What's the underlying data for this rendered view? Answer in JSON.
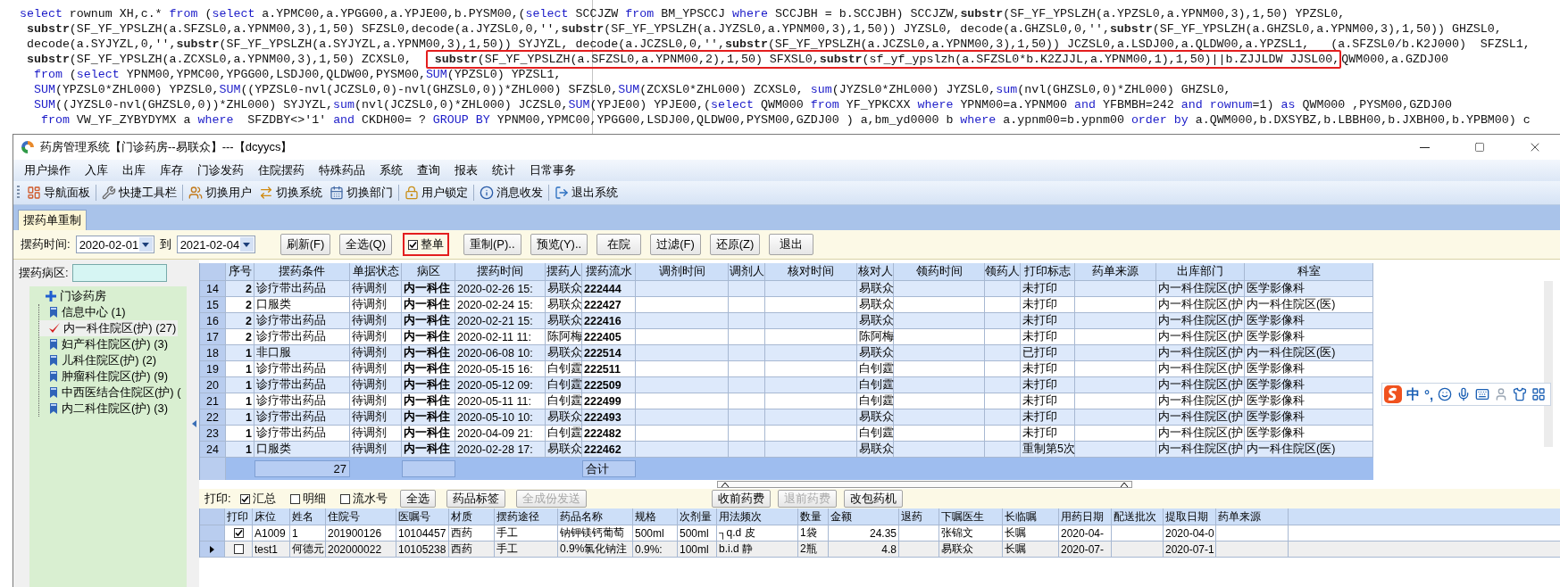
{
  "sql_editor": {
    "lines": [
      {
        "segments": [
          {
            "text": "select",
            "kind": "keyword"
          },
          {
            "text": " rownum XH,c.* ",
            "kind": "plain"
          },
          {
            "text": "from",
            "kind": "keyword"
          },
          {
            "text": " (",
            "kind": "plain"
          },
          {
            "text": "select",
            "kind": "keyword"
          },
          {
            "text": " a.YPMC00,a.YPGG00,a.YPJE00,b.PYSM00,(",
            "kind": "plain"
          },
          {
            "text": "select",
            "kind": "keyword"
          },
          {
            "text": " SCCJZW ",
            "kind": "plain"
          },
          {
            "text": "from",
            "kind": "keyword"
          },
          {
            "text": " BM_YPSCCJ ",
            "kind": "plain"
          },
          {
            "text": "where",
            "kind": "keyword"
          },
          {
            "text": " SCCJBH = b.SCCJBH) SCCJZW,",
            "kind": "plain"
          },
          {
            "text": "substr",
            "kind": "function"
          },
          {
            "text": "(SF_YF_YPSLZH(a.YPZSL0,a.YPNM00,3),1,50) YPZSL0,",
            "kind": "plain"
          }
        ]
      },
      {
        "segments": [
          {
            "text": " substr",
            "kind": "function"
          },
          {
            "text": "(SF_YF_YPSLZH(a.SFZSL0,a.YPNM00,3),1,50) SFZSL0,decode(a.JYZSL0,0,'',",
            "kind": "plain"
          },
          {
            "text": "substr",
            "kind": "function"
          },
          {
            "text": "(SF_YF_YPSLZH(a.JYZSL0,a.YPNM00,3),1,50)) JYZSL0, decode(a.GHZSL0,0,'',",
            "kind": "plain"
          },
          {
            "text": "substr",
            "kind": "function"
          },
          {
            "text": "(SF_YF_YPSLZH(a.GHZSL0,a.YPNM00,3),1,50)) GHZSL0,",
            "kind": "plain"
          }
        ]
      },
      {
        "segments": [
          {
            "text": " decode(a.SYJYZL,0,'',",
            "kind": "plain"
          },
          {
            "text": "substr",
            "kind": "function"
          },
          {
            "text": "(SF_YF_YPSLZH(a.SYJYZL,a.YPNM00,3),1,50)) SYJYZL, decode(a.JCZSL0,0,'',",
            "kind": "plain"
          },
          {
            "text": "substr",
            "kind": "function"
          },
          {
            "text": "(SF_YF_YPSLZH(a.JCZSL0,a.YPNM00,3),1,50)) JCZSL0,a.LSDJ00,a.QLDW00,a.YPZSL1,   (a.SFZSL0/b.K2J000)  SFZSL1,",
            "kind": "plain"
          }
        ]
      },
      {
        "segments": [
          {
            "text": " substr",
            "kind": "function"
          },
          {
            "text": "(SF_YF_YPSLZH(a.ZCXSL0,a.YPNM00,3),1,50) ZCXSL0,  ",
            "kind": "plain"
          },
          {
            "kind": "highlight",
            "segments": [
              {
                "text": " substr",
                "kind": "function"
              },
              {
                "text": "(SF_YF_YPSLZH(a.SFZSL0,a.YPNM00,2),1,50) SFXSL0,",
                "kind": "plain"
              },
              {
                "text": "substr",
                "kind": "function"
              },
              {
                "text": "(sf_yf_ypslzh(a.SFZSL0*b.K2ZJJL,a.YPNM00,1),1,50)||b.ZJJLDW JJSL00,",
                "kind": "plain"
              }
            ]
          },
          {
            "text": "QWM000,a.GZDJ00",
            "kind": "plain"
          }
        ]
      },
      {
        "segments": [
          {
            "text": "  from",
            "kind": "keyword"
          },
          {
            "text": " (",
            "kind": "plain"
          },
          {
            "text": "select",
            "kind": "keyword"
          },
          {
            "text": " YPNM00,YPMC00,YPGG00,LSDJ00,QLDW00,PYSM00,",
            "kind": "plain"
          },
          {
            "text": "SUM",
            "kind": "keyword"
          },
          {
            "text": "(YPZSL0) YPZSL1,",
            "kind": "plain"
          }
        ]
      },
      {
        "segments": [
          {
            "text": "  SUM",
            "kind": "keyword"
          },
          {
            "text": "(YPZSL0*ZHL000) YPZSL0,",
            "kind": "plain"
          },
          {
            "text": "SUM",
            "kind": "keyword"
          },
          {
            "text": "((YPZSL0-nvl(JCZSL0,0)-nvl(GHZSL0,0))*ZHL000) SFZSL0,",
            "kind": "plain"
          },
          {
            "text": "SUM",
            "kind": "keyword"
          },
          {
            "text": "(ZCXSL0*ZHL000) ZCXSL0, ",
            "kind": "plain"
          },
          {
            "text": "sum",
            "kind": "keyword"
          },
          {
            "text": "(JYZSL0*ZHL000) JYZSL0,",
            "kind": "plain"
          },
          {
            "text": "sum",
            "kind": "keyword"
          },
          {
            "text": "(nvl(GHZSL0,0)*ZHL000) GHZSL0,",
            "kind": "plain"
          }
        ]
      },
      {
        "segments": [
          {
            "text": "  SUM",
            "kind": "keyword"
          },
          {
            "text": "((JYZSL0-nvl(GHZSL0,0))*ZHL000) SYJYZL,",
            "kind": "plain"
          },
          {
            "text": "sum",
            "kind": "keyword"
          },
          {
            "text": "(nvl(JCZSL0,0)*ZHL000) JCZSL0,",
            "kind": "plain"
          },
          {
            "text": "SUM",
            "kind": "keyword"
          },
          {
            "text": "(YPJE00) YPJE00,(",
            "kind": "plain"
          },
          {
            "text": "select",
            "kind": "keyword"
          },
          {
            "text": " QWM000 ",
            "kind": "plain"
          },
          {
            "text": "from",
            "kind": "keyword"
          },
          {
            "text": " YF_YPKCXX ",
            "kind": "plain"
          },
          {
            "text": "where",
            "kind": "keyword"
          },
          {
            "text": " YPNM00=a.YPNM00 ",
            "kind": "plain"
          },
          {
            "text": "and",
            "kind": "keyword"
          },
          {
            "text": " YFBMBH=242 ",
            "kind": "plain"
          },
          {
            "text": "and rownum",
            "kind": "keyword"
          },
          {
            "text": "=1) ",
            "kind": "plain"
          },
          {
            "text": "as",
            "kind": "keyword"
          },
          {
            "text": " QWM000 ,PYSM00,GZDJ00",
            "kind": "plain"
          }
        ]
      },
      {
        "segments": [
          {
            "text": "   from",
            "kind": "keyword"
          },
          {
            "text": " VW_YF_ZYBYDYMX a ",
            "kind": "plain"
          },
          {
            "text": "where",
            "kind": "keyword"
          },
          {
            "text": "  SFZDBY<>'1' ",
            "kind": "plain"
          },
          {
            "text": "and",
            "kind": "keyword"
          },
          {
            "text": " CKDH00= ? ",
            "kind": "plain"
          },
          {
            "text": "GROUP BY",
            "kind": "keyword"
          },
          {
            "text": " YPNM00,YPMC00,YPGG00,LSDJ00,QLDW00,PYSM00,GZDJ00 ) a,bm_yd0000 b ",
            "kind": "plain"
          },
          {
            "text": "where",
            "kind": "keyword"
          },
          {
            "text": " a.ypnm00=b.ypnm00 ",
            "kind": "plain"
          },
          {
            "text": "order by",
            "kind": "keyword"
          },
          {
            "text": " a.QWM000,b.DXSYBZ,b.LBBH00,b.JXBH00,b.YPBM00) c",
            "kind": "plain"
          }
        ]
      }
    ]
  },
  "window": {
    "title": "药房管理系统【门诊药房--易联众】---【dcyycs】"
  },
  "menu": [
    "用户操作",
    "入库",
    "出库",
    "库存",
    "门诊发药",
    "住院摆药",
    "特殊药品",
    "系统",
    "查询",
    "报表",
    "统计",
    "日常事务"
  ],
  "toolbar": [
    [
      "导航面板"
    ],
    [
      "快捷工具栏"
    ],
    [
      "切换用户",
      "切换系统",
      "切换部门"
    ],
    [
      "用户锁定"
    ],
    [
      "消息收发"
    ],
    [
      "退出系统"
    ]
  ],
  "tabs": [
    {
      "label": "摆药单重制",
      "selected": true
    }
  ],
  "filter_bar": {
    "time_label": "摆药时间:",
    "date_from": "2020-02-01",
    "to_label": "到",
    "date_to": "2021-02-04",
    "controls": [
      {
        "kind": "button",
        "label": "刷新(F)"
      },
      {
        "kind": "button",
        "label": "全选(Q)"
      },
      {
        "kind": "checkbox",
        "label": "整单",
        "checked": true,
        "highlighted": true
      },
      {
        "kind": "button",
        "label": "重制(P).."
      },
      {
        "kind": "button",
        "label": "预览(Y).."
      },
      {
        "kind": "button",
        "label": "在院"
      },
      {
        "kind": "button",
        "label": "过滤(F)"
      },
      {
        "kind": "button",
        "label": "还原(Z)"
      },
      {
        "kind": "button",
        "label": "退出"
      }
    ]
  },
  "ward_panel": {
    "label": "摆药病区:",
    "tree": [
      {
        "label": "门诊药房",
        "children": [
          {
            "label": "信息中心 (1)",
            "selected": false
          },
          {
            "label": "内一科住院区(护) (27)",
            "selected": true
          },
          {
            "label": "妇产科住院区(护) (3)",
            "selected": false
          },
          {
            "label": "儿科住院区(护) (2)",
            "selected": false
          },
          {
            "label": "肿瘤科住院区(护) (9)",
            "selected": false
          },
          {
            "label": "中西医结合住院区(护) (",
            "selected": false
          },
          {
            "label": "内二科住院区(护) (3)",
            "selected": false
          }
        ]
      }
    ]
  },
  "order_table": {
    "columns": [
      "序号",
      "摆药条件",
      "单据状态",
      "病区",
      "摆药时间",
      "摆药人",
      "摆药流水",
      "调剂时间",
      "调剂人",
      "核对时间",
      "核对人",
      "领药时间",
      "领药人",
      "打印标志",
      "药单来源",
      "出库部门",
      "科室"
    ],
    "rows": [
      {
        "row": "14",
        "cells": [
          "2",
          "诊疗带出药品",
          "待调剂",
          "内一科住",
          "2020-02-26 15:",
          "易联众",
          "222444",
          null,
          null,
          null,
          "易联众",
          null,
          null,
          "未打印",
          null,
          "内一科住院区(护",
          "医学影像科"
        ]
      },
      {
        "row": "15",
        "cells": [
          "2",
          "口服类",
          "待调剂",
          "内一科住",
          "2020-02-24 15:",
          "易联众",
          "222427",
          null,
          null,
          null,
          "易联众",
          null,
          null,
          "未打印",
          null,
          "内一科住院区(护",
          "内一科住院区(医)"
        ]
      },
      {
        "row": "16",
        "cells": [
          "2",
          "诊疗带出药品",
          "待调剂",
          "内一科住",
          "2020-02-21 15:",
          "易联众",
          "222416",
          null,
          null,
          null,
          "易联众",
          null,
          null,
          "未打印",
          null,
          "内一科住院区(护",
          "医学影像科"
        ]
      },
      {
        "row": "17",
        "cells": [
          "2",
          "诊疗带出药品",
          "待调剂",
          "内一科住",
          "2020-02-11 11:",
          "陈阿梅",
          "222405",
          null,
          null,
          null,
          "陈阿梅",
          null,
          null,
          "未打印",
          null,
          "内一科住院区(护",
          "医学影像科"
        ]
      },
      {
        "row": "18",
        "cells": [
          "1",
          "非口服",
          "待调剂",
          "内一科住",
          "2020-06-08 10:",
          "易联众",
          "222514",
          null,
          null,
          null,
          "易联众",
          null,
          null,
          "已打印",
          null,
          "内一科住院区(护",
          "内一科住院区(医)"
        ]
      },
      {
        "row": "19",
        "cells": [
          "1",
          "诊疗带出药品",
          "待调剂",
          "内一科住",
          "2020-05-15 16:",
          "白钊霆",
          "222511",
          null,
          null,
          null,
          "白钊霆",
          null,
          null,
          "未打印",
          null,
          "内一科住院区(护",
          "医学影像科"
        ]
      },
      {
        "row": "20",
        "cells": [
          "1",
          "诊疗带出药品",
          "待调剂",
          "内一科住",
          "2020-05-12 09:",
          "白钊霆",
          "222509",
          null,
          null,
          null,
          "白钊霆",
          null,
          null,
          "未打印",
          null,
          "内一科住院区(护",
          "医学影像科"
        ]
      },
      {
        "row": "21",
        "cells": [
          "1",
          "诊疗带出药品",
          "待调剂",
          "内一科住",
          "2020-05-11 11:",
          "白钊霆",
          "222499",
          null,
          null,
          null,
          "白钊霆",
          null,
          null,
          "未打印",
          null,
          "内一科住院区(护",
          "医学影像科"
        ]
      },
      {
        "row": "22",
        "cells": [
          "1",
          "诊疗带出药品",
          "待调剂",
          "内一科住",
          "2020-05-10 10:",
          "易联众",
          "222493",
          null,
          null,
          null,
          "易联众",
          null,
          null,
          "未打印",
          null,
          "内一科住院区(护",
          "医学影像科"
        ]
      },
      {
        "row": "23",
        "cells": [
          "1",
          "诊疗带出药品",
          "待调剂",
          "内一科住",
          "2020-04-09 21:",
          "白钊霆",
          "222482",
          null,
          null,
          null,
          "白钊霆",
          null,
          null,
          "未打印",
          null,
          "内一科住院区(护",
          "医学影像科"
        ]
      },
      {
        "row": "24",
        "cells": [
          "1",
          "口服类",
          "待调剂",
          "内一科住",
          "2020-02-28 17:",
          "易联众",
          "222462",
          null,
          null,
          null,
          "易联众",
          null,
          null,
          "重制第5次",
          null,
          "内一科住院区(护",
          "内一科住院区(医)"
        ]
      }
    ],
    "footer": [
      "27",
      "合计"
    ]
  },
  "print_bar": {
    "label": "打印:",
    "options": [
      {
        "label": "汇总",
        "checked": true
      },
      {
        "label": "明细",
        "checked": false
      },
      {
        "label": "流水号",
        "checked": false
      }
    ],
    "buttons": [
      {
        "label": "全选",
        "disabled": false
      },
      {
        "label": "药品标签",
        "disabled": false
      },
      {
        "label": "全成份发送",
        "disabled": true
      }
    ],
    "fee_buttons": [
      {
        "label": "收前药费",
        "disabled": false
      },
      {
        "label": "退前药费",
        "disabled": true
      },
      {
        "label": "改包药机",
        "disabled": false
      }
    ]
  },
  "detail_table": {
    "check_column": "打印",
    "columns": [
      "床位",
      "姓名",
      "住院号",
      "医嘱号",
      "材质",
      "摆药途径",
      "药品名称",
      "规格",
      "次剂量",
      "用法频次",
      "数量",
      "金额",
      "退药",
      "下嘱医生",
      "长临嘱",
      "用药日期",
      "配送批次",
      "提取日期",
      "药单来源"
    ],
    "rows": [
      {
        "current": false,
        "checked": true,
        "cells": [
          "A1009",
          "1",
          "201900126",
          "10104457",
          "西药",
          "手工",
          "钠钾镁钙葡萄",
          "500ml",
          "500ml",
          "┐q.d 皮",
          "1袋",
          "24.35",
          null,
          "张锦文",
          "长嘱",
          "2020-04-",
          null,
          "2020-04-0"
        ]
      },
      {
        "current": true,
        "checked": false,
        "cells": [
          "test1",
          "何德元",
          "202000022",
          "10105238",
          "西药",
          "手工",
          "0.9%氯化钠注",
          "0.9%:",
          "100ml",
          "b.i.d 静",
          "2瓶",
          "4.8",
          null,
          "易联众",
          "长嘱",
          "2020-07-",
          null,
          "2020-07-1"
        ]
      }
    ]
  },
  "ime_toolbar": {
    "mode": "中",
    "punctuation": "°,"
  }
}
